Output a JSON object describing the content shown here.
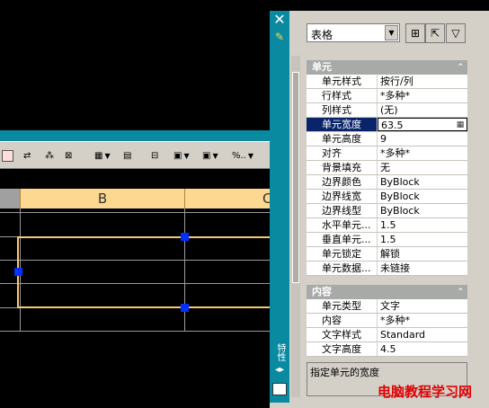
{
  "canvas": {
    "toolbar_items": [
      "⇄",
      "⁂",
      "⊠",
      "▦",
      "▤",
      "⊟",
      "▣",
      "%.."
    ],
    "columns": [
      "B",
      "C"
    ]
  },
  "palette": {
    "side_title": "特性",
    "object_type": "表格",
    "sections": [
      {
        "title": "单元",
        "rows": [
          {
            "label": "单元样式",
            "value": "按行/列"
          },
          {
            "label": "行样式",
            "value": "*多种*"
          },
          {
            "label": "列样式",
            "value": "(无)"
          },
          {
            "label": "单元宽度",
            "value": "63.5"
          },
          {
            "label": "单元高度",
            "value": "9"
          },
          {
            "label": "对齐",
            "value": "*多种*"
          },
          {
            "label": "背景填充",
            "value": "无"
          },
          {
            "label": "边界颜色",
            "value": "ByBlock"
          },
          {
            "label": "边界线宽",
            "value": "ByBlock"
          },
          {
            "label": "边界线型",
            "value": "ByBlock"
          },
          {
            "label": "水平单元...",
            "value": "1.5"
          },
          {
            "label": "垂直单元...",
            "value": "1.5"
          },
          {
            "label": "单元锁定",
            "value": "解锁"
          },
          {
            "label": "单元数据...",
            "value": "未链接"
          }
        ]
      },
      {
        "title": "内容",
        "rows": [
          {
            "label": "单元类型",
            "value": "文字"
          },
          {
            "label": "内容",
            "value": "*多种*"
          },
          {
            "label": "文字样式",
            "value": "Standard"
          },
          {
            "label": "文字高度",
            "value": "4.5"
          }
        ]
      }
    ],
    "selected_row": "单元宽度",
    "description": "指定单元的宽度"
  },
  "watermark": "电脑教程学习网",
  "colors": {
    "teal": "#0a8aa0",
    "header": "#fcd890",
    "selection": "#f8c878",
    "grip": "#0030ff",
    "selected_row": "#0a246a"
  }
}
